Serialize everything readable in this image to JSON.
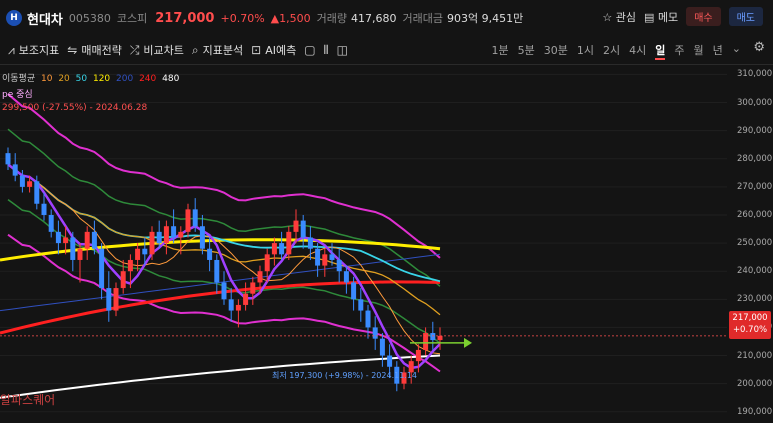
{
  "header": {
    "logo_text": "H",
    "stock_name": "현대차",
    "stock_code": "005380",
    "market": "코스피",
    "price": "217,000",
    "change_pct": "+0.70%",
    "change_abs": "▲1,500",
    "volume_label": "거래량",
    "volume": "417,680",
    "amount_label": "거래대금",
    "amount": "903억 9,451만",
    "watch": "관심",
    "memo": "메모",
    "buy": "매수",
    "sell": "매도"
  },
  "toolbar": {
    "items": [
      "보조지표",
      "매매전략",
      "비교차트",
      "지표분석",
      "AI예측"
    ],
    "periods": [
      "1분",
      "5분",
      "30분",
      "1시",
      "2시",
      "4시",
      "일",
      "주",
      "월",
      "년"
    ],
    "selected_period": "일"
  },
  "legend": {
    "ma_label": "이동평균",
    "ma_periods": [
      {
        "label": "10",
        "color": "#ff9a3c"
      },
      {
        "label": "20",
        "color": "#e0a020"
      },
      {
        "label": "50",
        "color": "#39d5e8"
      },
      {
        "label": "120",
        "color": "#ffee00"
      },
      {
        "label": "200",
        "color": "#3050c0"
      },
      {
        "label": "240",
        "color": "#ff2020"
      },
      {
        "label": "480",
        "color": "#ffffff"
      }
    ],
    "envelope": "pe 중심",
    "high_note": "299,500 (-27.55%) - 2024.06.28"
  },
  "annotations": {
    "low_note": "최저 197,300 (+9.98%) - 2024.11.14",
    "brand": "알파스퀘어"
  },
  "axis": {
    "ticks": [
      "310,000",
      "300,000",
      "290,000",
      "280,000",
      "270,000",
      "260,000",
      "250,000",
      "240,000",
      "230,000",
      "220,000",
      "210,000",
      "200,000",
      "190,000"
    ],
    "current_price": "217,000",
    "current_change": "+0.70%"
  },
  "chart_data": {
    "type": "candlestick",
    "ylim": [
      186000,
      313000
    ],
    "current": 217000,
    "candles": [
      [
        282000,
        284000,
        276000,
        278000
      ],
      [
        278000,
        282000,
        272000,
        274000
      ],
      [
        274000,
        276000,
        268000,
        270000
      ],
      [
        270000,
        274000,
        268000,
        272000
      ],
      [
        272000,
        274000,
        262000,
        264000
      ],
      [
        264000,
        268000,
        258000,
        260000
      ],
      [
        260000,
        262000,
        252000,
        254000
      ],
      [
        254000,
        258000,
        246000,
        250000
      ],
      [
        250000,
        256000,
        246000,
        252000
      ],
      [
        252000,
        254000,
        240000,
        244000
      ],
      [
        244000,
        250000,
        236000,
        248000
      ],
      [
        248000,
        256000,
        244000,
        254000
      ],
      [
        254000,
        258000,
        246000,
        248000
      ],
      [
        248000,
        250000,
        230000,
        234000
      ],
      [
        234000,
        240000,
        222000,
        226000
      ],
      [
        226000,
        236000,
        224000,
        234000
      ],
      [
        234000,
        244000,
        232000,
        240000
      ],
      [
        240000,
        246000,
        234000,
        244000
      ],
      [
        244000,
        250000,
        240000,
        248000
      ],
      [
        248000,
        252000,
        242000,
        246000
      ],
      [
        246000,
        256000,
        244000,
        254000
      ],
      [
        254000,
        258000,
        248000,
        250000
      ],
      [
        250000,
        258000,
        246000,
        256000
      ],
      [
        256000,
        262000,
        250000,
        252000
      ],
      [
        252000,
        256000,
        246000,
        254000
      ],
      [
        254000,
        264000,
        252000,
        262000
      ],
      [
        262000,
        266000,
        254000,
        256000
      ],
      [
        256000,
        260000,
        246000,
        248000
      ],
      [
        248000,
        252000,
        240000,
        244000
      ],
      [
        244000,
        246000,
        232000,
        236000
      ],
      [
        236000,
        240000,
        228000,
        230000
      ],
      [
        230000,
        234000,
        222000,
        226000
      ],
      [
        226000,
        230000,
        220000,
        228000
      ],
      [
        228000,
        236000,
        226000,
        232000
      ],
      [
        232000,
        238000,
        228000,
        236000
      ],
      [
        236000,
        242000,
        232000,
        240000
      ],
      [
        240000,
        248000,
        236000,
        246000
      ],
      [
        246000,
        252000,
        242000,
        250000
      ],
      [
        250000,
        254000,
        244000,
        246000
      ],
      [
        246000,
        256000,
        244000,
        254000
      ],
      [
        254000,
        262000,
        250000,
        258000
      ],
      [
        258000,
        260000,
        248000,
        252000
      ],
      [
        252000,
        256000,
        244000,
        248000
      ],
      [
        248000,
        250000,
        238000,
        242000
      ],
      [
        242000,
        248000,
        238000,
        246000
      ],
      [
        246000,
        250000,
        242000,
        244000
      ],
      [
        244000,
        248000,
        236000,
        240000
      ],
      [
        240000,
        242000,
        232000,
        236000
      ],
      [
        236000,
        238000,
        226000,
        230000
      ],
      [
        230000,
        234000,
        222000,
        226000
      ],
      [
        226000,
        228000,
        216000,
        220000
      ],
      [
        220000,
        224000,
        212000,
        216000
      ],
      [
        216000,
        218000,
        206000,
        210000
      ],
      [
        210000,
        214000,
        202000,
        206000
      ],
      [
        206000,
        208000,
        197300,
        200000
      ],
      [
        200000,
        206000,
        198000,
        204000
      ],
      [
        204000,
        210000,
        200000,
        208000
      ],
      [
        208000,
        214000,
        204000,
        212000
      ],
      [
        212000,
        220000,
        210000,
        218000
      ],
      [
        218000,
        222000,
        212000,
        215500
      ],
      [
        215500,
        220000,
        212000,
        217000
      ]
    ]
  }
}
